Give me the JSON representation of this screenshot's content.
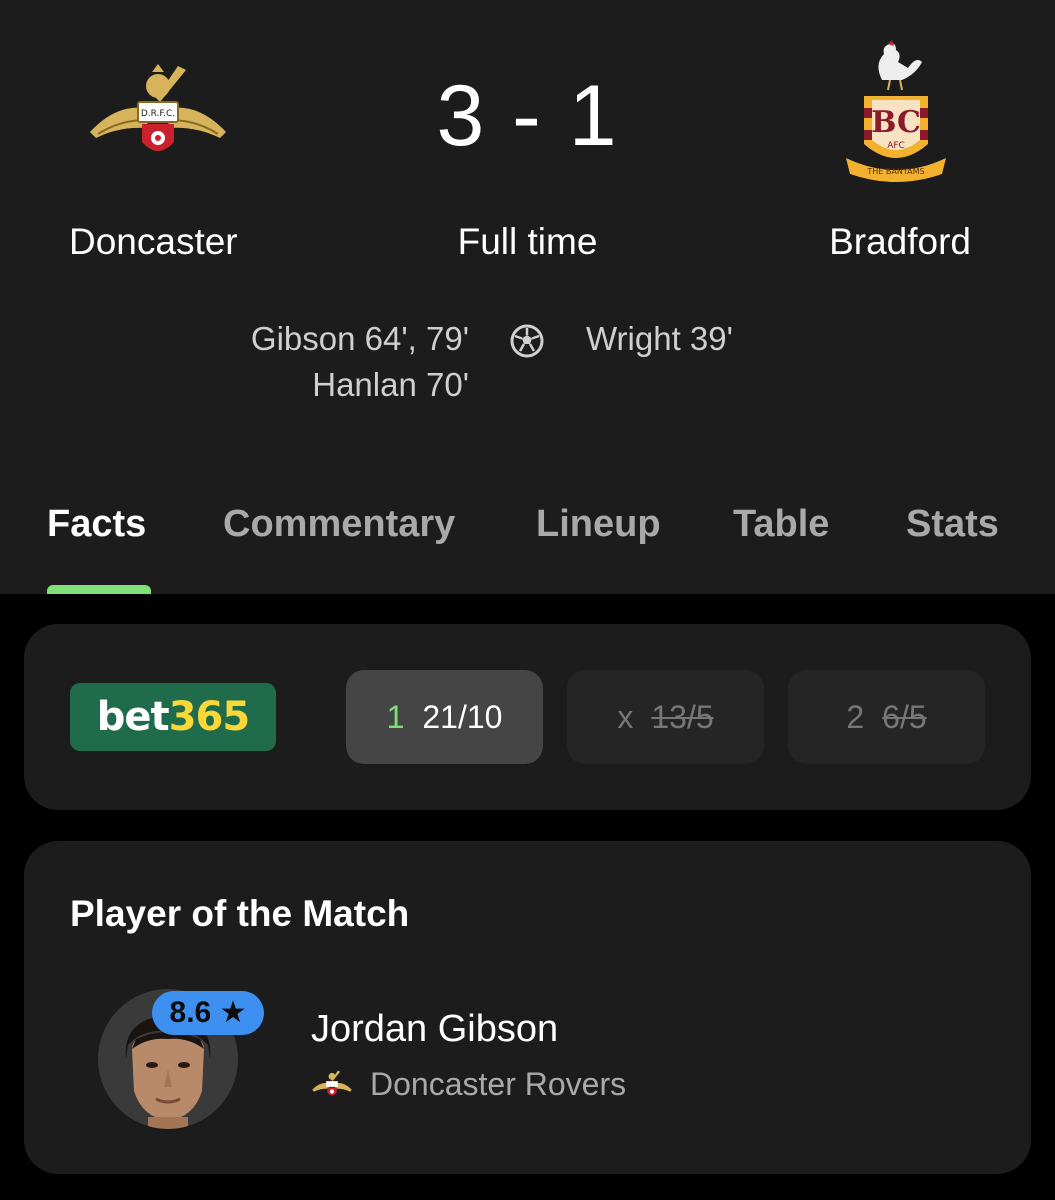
{
  "match": {
    "score": "3 - 1",
    "status": "Full time",
    "home": {
      "name": "Doncaster",
      "crest_text": "D.R.F.C.",
      "scorers": [
        "Gibson 64', 79'",
        "Hanlan 70'"
      ]
    },
    "away": {
      "name": "Bradford",
      "crest_text": "BC",
      "crest_sub": "AFC",
      "crest_banner": "THE BANTAMS",
      "scorers": [
        "Wright 39'"
      ]
    },
    "goal_icon": "football-icon"
  },
  "tabs": [
    {
      "label": "Facts",
      "active": true
    },
    {
      "label": "Commentary"
    },
    {
      "label": "Lineup"
    },
    {
      "label": "Table"
    },
    {
      "label": "Stats"
    }
  ],
  "odds": {
    "provider_word": "bet",
    "provider_num": "365",
    "options": [
      {
        "label": "1",
        "value": "21/10",
        "selected": true
      },
      {
        "label": "x",
        "value": "13/5",
        "struck": true
      },
      {
        "label": "2",
        "value": "6/5",
        "struck": true
      }
    ]
  },
  "potm": {
    "title": "Player of the Match",
    "rating": "8.6",
    "rating_icon": "star-icon",
    "player_name": "Jordan Gibson",
    "club": "Doncaster Rovers"
  },
  "colors": {
    "accent_green": "#7fe07a",
    "rating_blue": "#3d90f0",
    "bet365_green": "#1f6b4c",
    "bet365_yellow": "#fbd83a"
  }
}
